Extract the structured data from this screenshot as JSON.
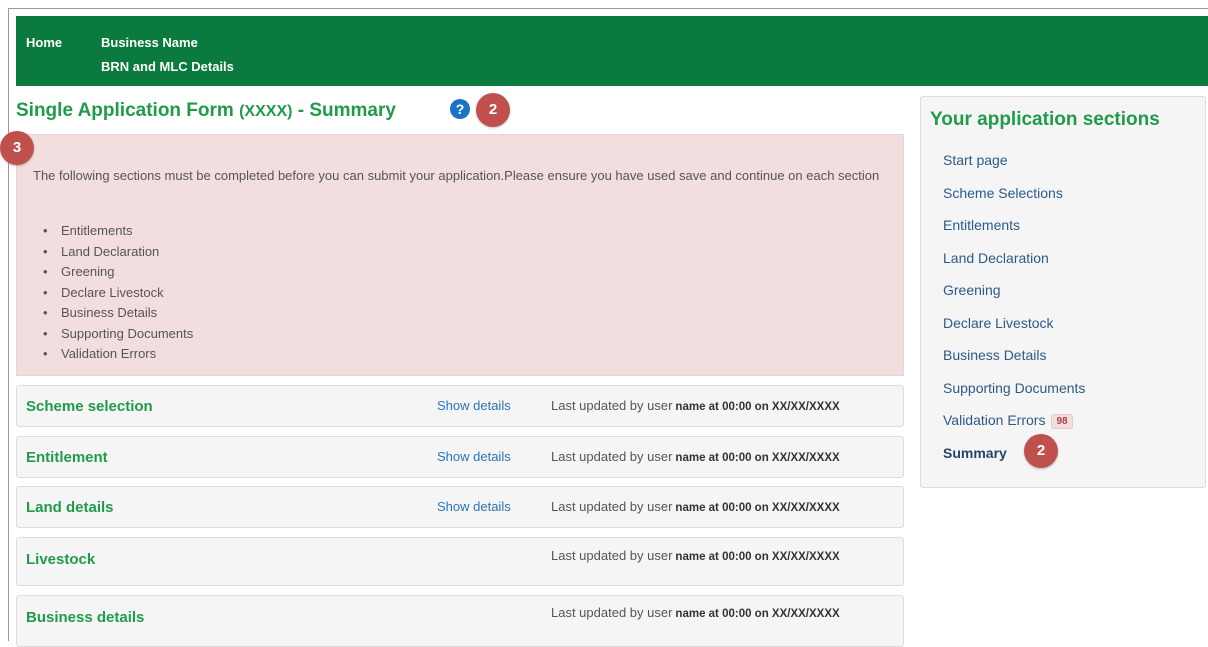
{
  "topbar": {
    "home_label": "Home",
    "business_name": "Business Name",
    "brn_details": "BRN and MLC Details"
  },
  "page": {
    "title_main": "Single Application Form",
    "title_code": "(XXXX)",
    "title_suffix": "- Summary",
    "help_glyph": "?"
  },
  "alert": {
    "message": "The following sections must be completed before you can submit your application.Please ensure you have used save and continue on each section",
    "items": [
      "Entitlements",
      "Land Declaration",
      "Greening",
      "Declare Livestock",
      "Business Details",
      "Supporting Documents",
      "Validation Errors"
    ]
  },
  "sections": [
    {
      "title": "Scheme selection",
      "show": "Show details",
      "updated_prefix": "Last updated by user",
      "updated_detail": "name at 00:00 on XX/XX/XXXX"
    },
    {
      "title": "Entitlement",
      "show": "Show details",
      "updated_prefix": "Last updated by user",
      "updated_detail": "name at 00:00 on XX/XX/XXXX"
    },
    {
      "title": "Land details",
      "show": "Show details",
      "updated_prefix": "Last updated by user",
      "updated_detail": "name at 00:00 on XX/XX/XXXX"
    },
    {
      "title": "Livestock",
      "updated_prefix": "Last updated by user",
      "updated_detail": "name at 00:00 on XX/XX/XXXX"
    },
    {
      "title": "Business details",
      "updated_prefix": "Last updated by user",
      "updated_detail": "name at 00:00 on XX/XX/XXXX"
    }
  ],
  "sidebar": {
    "title": "Your application sections",
    "items": [
      {
        "label": "Start page"
      },
      {
        "label": "Scheme Selections"
      },
      {
        "label": "Entitlements"
      },
      {
        "label": "Land Declaration"
      },
      {
        "label": "Greening"
      },
      {
        "label": "Declare Livestock"
      },
      {
        "label": "Business Details"
      },
      {
        "label": "Supporting Documents"
      },
      {
        "label": "Validation Errors",
        "badge": "98"
      },
      {
        "label": "Summary"
      }
    ]
  },
  "callouts": {
    "title_marker": "2",
    "alert_marker": "3",
    "summary_marker": "2"
  },
  "colors": {
    "topbar": "#0b7a3e",
    "heading_green": "#1f9b4a",
    "link_blue": "#2a73b8",
    "alert_bg": "#f2dede",
    "callout_red": "#c0504d",
    "help_blue": "#1a74c2"
  }
}
